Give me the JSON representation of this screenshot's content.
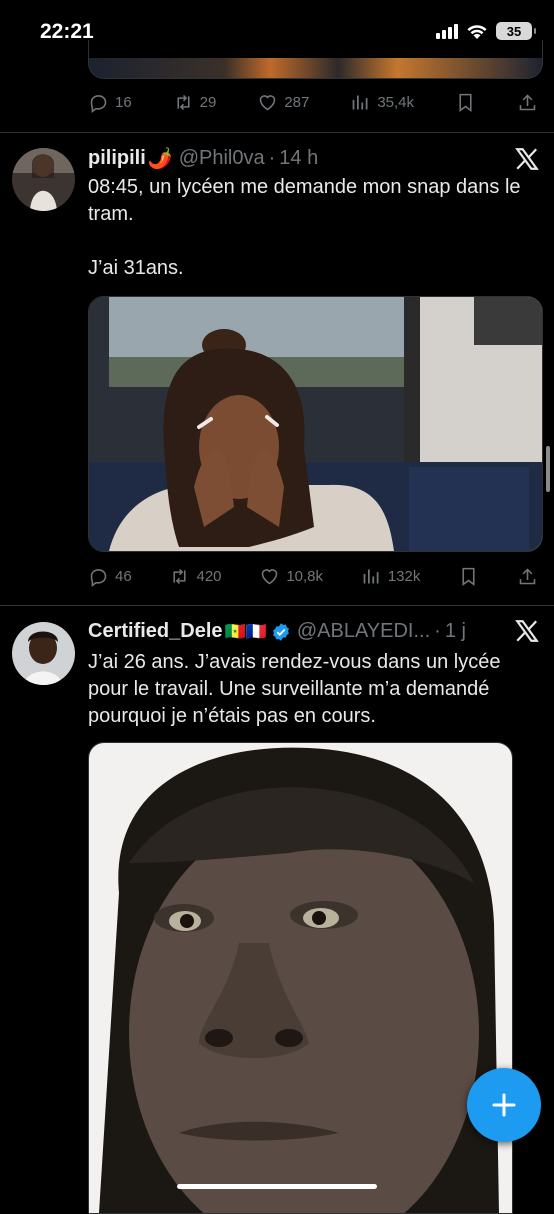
{
  "status_bar": {
    "time": "22:21",
    "battery": "35"
  },
  "tweet_previous": {
    "replies": "16",
    "reposts": "29",
    "likes": "287",
    "views": "35,4k"
  },
  "tweet1": {
    "name": "pilipili",
    "name_emoji": "🌶️",
    "handle": "@Phil0va",
    "sep": "·",
    "time": "14 h",
    "text": "08:45, un lycéen me demande mon snap dans le tram.\n\nJ’ai 31ans.",
    "replies": "46",
    "reposts": "420",
    "likes": "10,8k",
    "views": "132k"
  },
  "tweet2": {
    "name": "Certified_Dele",
    "name_flags": "🇸🇳🇫🇷",
    "handle": "@ABLAYEDI...",
    "sep": "·",
    "time": "1 j",
    "text": "J’ai 26 ans. J’avais rendez-vous dans un lycée pour le travail. Une surveillante m’a demandé pourquoi je n’étais pas en cours."
  },
  "colors": {
    "accent": "#1d9bf0",
    "muted": "#71767b",
    "divider": "#2f3336"
  }
}
